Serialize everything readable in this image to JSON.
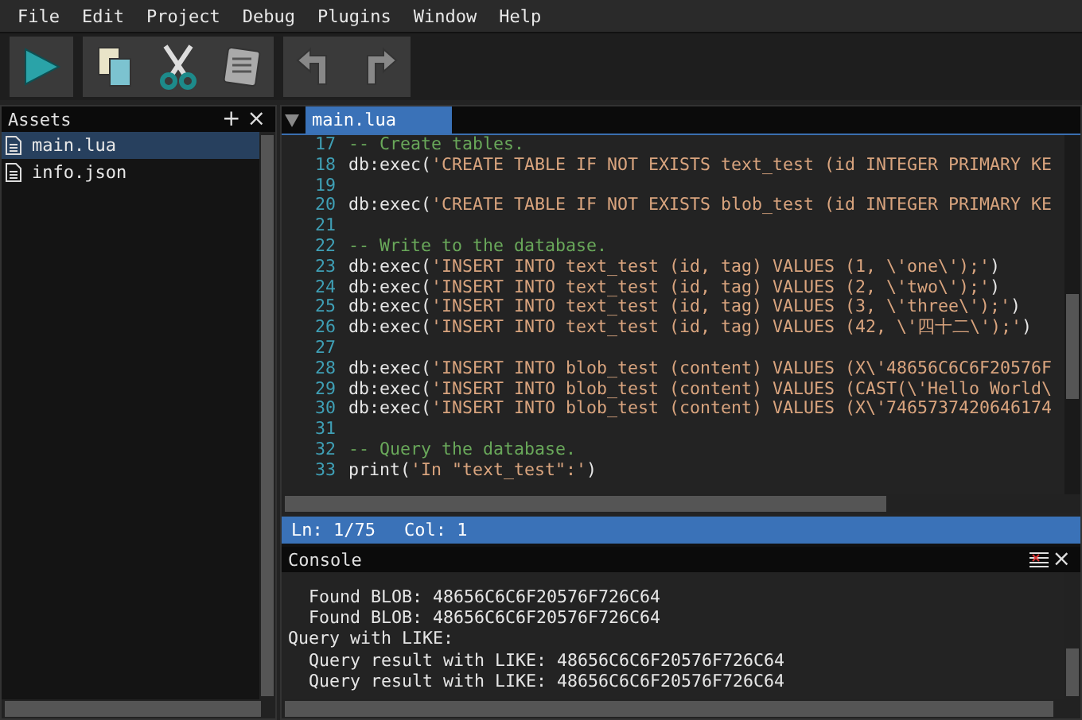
{
  "menu": [
    "File",
    "Edit",
    "Project",
    "Debug",
    "Plugins",
    "Window",
    "Help"
  ],
  "toolbar": [
    {
      "group": [
        {
          "kind": "run"
        }
      ]
    },
    {
      "group": [
        {
          "kind": "copy"
        },
        {
          "kind": "cut"
        },
        {
          "kind": "paste"
        }
      ]
    },
    {
      "group": [
        {
          "kind": "undo"
        },
        {
          "kind": "redo"
        }
      ]
    }
  ],
  "assets": {
    "title": "Assets",
    "add": "+",
    "close": "×",
    "items": [
      {
        "label": "main.lua",
        "selected": true
      },
      {
        "label": "info.json",
        "selected": false
      }
    ]
  },
  "editor": {
    "tabs": [
      {
        "label": "main.lua",
        "selected": true
      }
    ],
    "lines": [
      {
        "number": "17",
        "parts": [
          {
            "kind": "comment",
            "text": "-- Create tables."
          }
        ]
      },
      {
        "number": "18",
        "parts": [
          {
            "kind": "plain",
            "text": "db:exec("
          },
          {
            "kind": "string",
            "text": "'CREATE TABLE IF NOT EXISTS text_test (id INTEGER PRIMARY KE"
          }
        ]
      },
      {
        "number": "19"
      },
      {
        "number": "20",
        "parts": [
          {
            "kind": "plain",
            "text": "db:exec("
          },
          {
            "kind": "string",
            "text": "'CREATE TABLE IF NOT EXISTS blob_test (id INTEGER PRIMARY KE"
          }
        ]
      },
      {
        "number": "21"
      },
      {
        "number": "22",
        "parts": [
          {
            "kind": "comment",
            "text": "-- Write to the database."
          }
        ]
      },
      {
        "number": "23",
        "parts": [
          {
            "kind": "plain",
            "text": "db:exec("
          },
          {
            "kind": "string",
            "text": "'INSERT INTO text_test (id, tag) VALUES (1, \\'one\\');'"
          },
          {
            "kind": "plain",
            "text": ")"
          }
        ]
      },
      {
        "number": "24",
        "parts": [
          {
            "kind": "plain",
            "text": "db:exec("
          },
          {
            "kind": "string",
            "text": "'INSERT INTO text_test (id, tag) VALUES (2, \\'two\\');'"
          },
          {
            "kind": "plain",
            "text": ")"
          }
        ]
      },
      {
        "number": "25",
        "parts": [
          {
            "kind": "plain",
            "text": "db:exec("
          },
          {
            "kind": "string",
            "text": "'INSERT INTO text_test (id, tag) VALUES (3, \\'three\\');'"
          },
          {
            "kind": "plain",
            "text": ")"
          }
        ]
      },
      {
        "number": "26",
        "parts": [
          {
            "kind": "plain",
            "text": "db:exec("
          },
          {
            "kind": "string",
            "text": "'INSERT INTO text_test (id, tag) VALUES (42, \\'四十二\\');'"
          },
          {
            "kind": "plain",
            "text": ")"
          }
        ]
      },
      {
        "number": "27"
      },
      {
        "number": "28",
        "parts": [
          {
            "kind": "plain",
            "text": "db:exec("
          },
          {
            "kind": "string",
            "text": "'INSERT INTO blob_test (content) VALUES (X\\'48656C6C6F20576F"
          }
        ]
      },
      {
        "number": "29",
        "parts": [
          {
            "kind": "plain",
            "text": "db:exec("
          },
          {
            "kind": "string",
            "text": "'INSERT INTO blob_test (content) VALUES (CAST(\\'Hello World\\"
          }
        ]
      },
      {
        "number": "30",
        "parts": [
          {
            "kind": "plain",
            "text": "db:exec("
          },
          {
            "kind": "string",
            "text": "'INSERT INTO blob_test (content) VALUES (X\\'7465737420646174"
          }
        ]
      },
      {
        "number": "31"
      },
      {
        "number": "32",
        "parts": [
          {
            "kind": "comment",
            "text": "-- Query the database."
          }
        ]
      },
      {
        "number": "33",
        "parts": [
          {
            "kind": "plain",
            "text": "print("
          },
          {
            "kind": "string",
            "text": "'In \"text_test\":'"
          },
          {
            "kind": "plain",
            "text": ")"
          }
        ]
      }
    ],
    "status": [
      "Ln: 1/75",
      "Col: 1"
    ]
  },
  "console": {
    "title": "Console",
    "close": "×",
    "lines": [
      "  Found BLOB: 48656C6C6F20576F726C64",
      "  Found BLOB: 48656C6C6F20576F726C64",
      "Query with LIKE:",
      "  Query result with LIKE: 48656C6C6F20576F726C64",
      "  Query result with LIKE: 48656C6C6F20576F726C64"
    ]
  }
}
